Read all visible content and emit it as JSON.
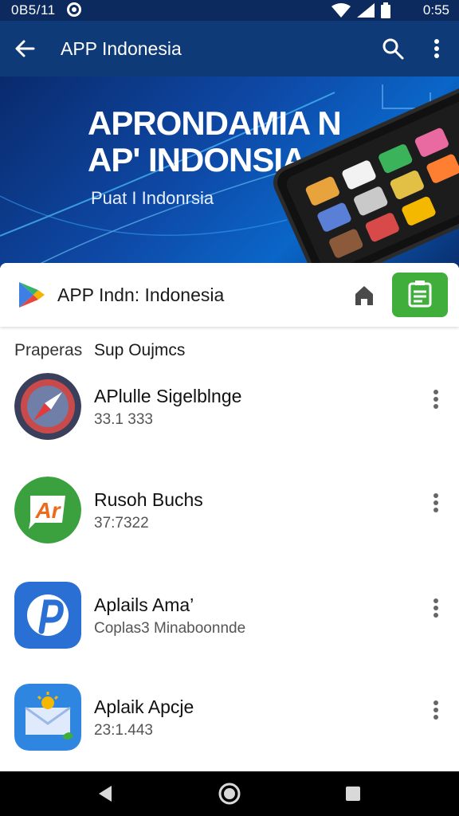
{
  "status_bar": {
    "time_left": "0B5/11",
    "time_right": "0:55"
  },
  "app_bar": {
    "title": "APP Indonesia",
    "icons": [
      "back-arrow-icon",
      "search-icon",
      "more-vert-icon"
    ]
  },
  "banner": {
    "title_line1": "APRONDAMIA  N",
    "title_line2": "AP' INDONSIA",
    "subtitle": "Puat I Indonrsia"
  },
  "app_header": {
    "name": "APP Indn: Indonesia",
    "icons": [
      "play-store-logo-icon",
      "home-icon",
      "install-icon"
    ],
    "accent": "#3fae3b"
  },
  "section": {
    "left_label": "Praperas",
    "right_label": "Sup Oujmcs"
  },
  "apps": [
    {
      "title": "APlulle Sigelblnge",
      "subtitle": "33.1 333",
      "icon": "compass-icon"
    },
    {
      "title": "Rusoh Buchs",
      "subtitle": "37:7322",
      "icon": "ar-logo-icon"
    },
    {
      "title": "Aplails Ama’",
      "subtitle": "Coplas3  Minaboonnde",
      "icon": "p-logo-icon"
    },
    {
      "title": "Aplaik Apcje",
      "subtitle": "23:1.443",
      "icon": "mail-sun-icon"
    }
  ],
  "nav_bar": {
    "icons": [
      "nav-back-icon",
      "nav-home-icon",
      "nav-recent-icon"
    ]
  },
  "colors": {
    "status_bar": "#0d2a5e",
    "app_bar": "#0f3a78",
    "banner_start": "#0a2a6c",
    "banner_end": "#0a66c8"
  }
}
